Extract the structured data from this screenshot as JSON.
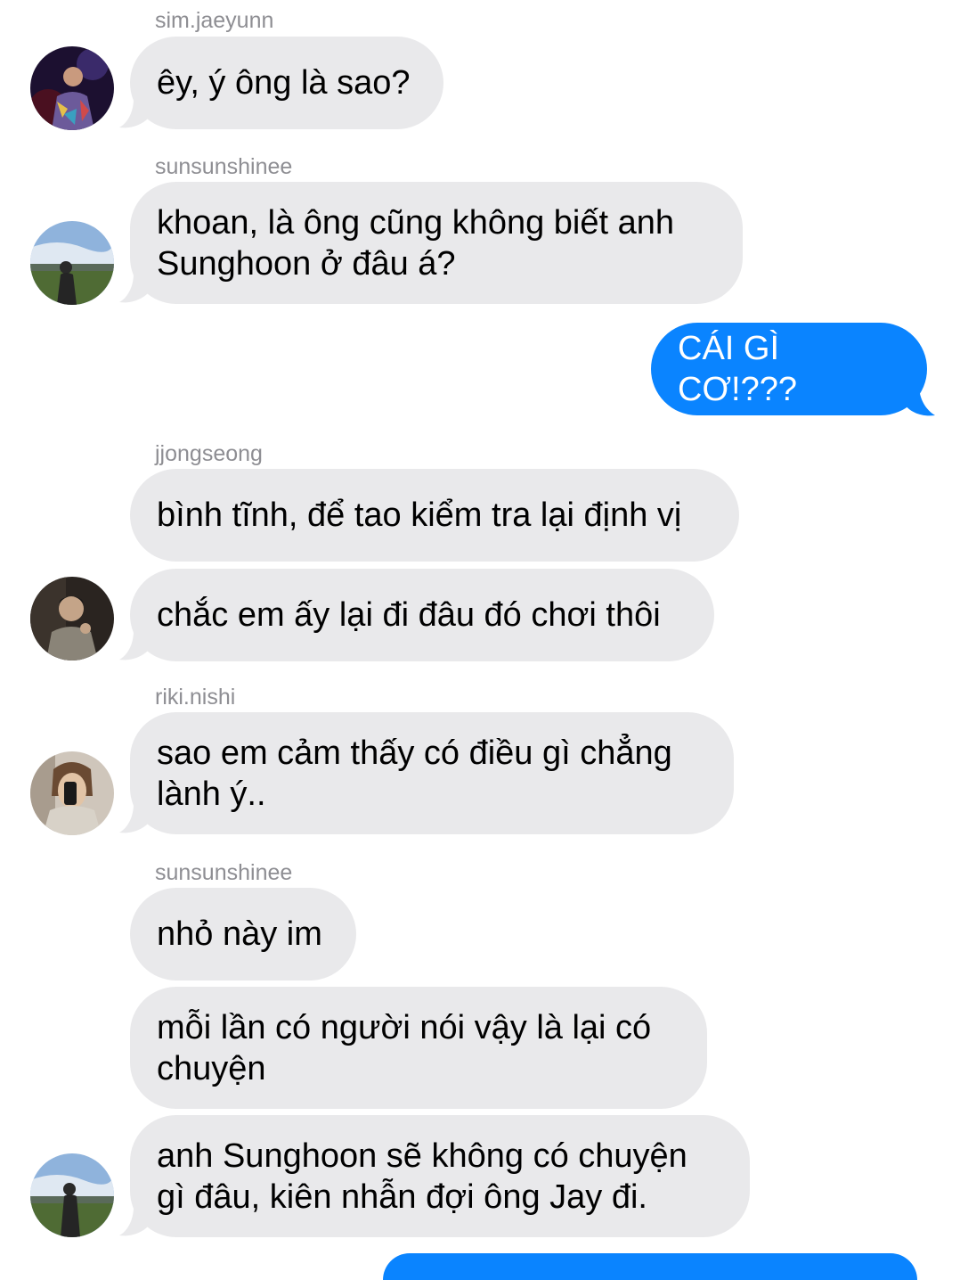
{
  "colors": {
    "incoming_bubble": "#e9e9eb",
    "outgoing_bubble": "#0a84ff",
    "sender_label": "#8e8e93"
  },
  "messages": [
    {
      "sender": "sim.jaeyunn",
      "text": "êy, ý ông là sao?",
      "direction": "incoming",
      "avatar": "avatar-stage-performer"
    },
    {
      "sender": "sunsunshinee",
      "text": "khoan, là ông cũng không biết anh Sunghoon ở đâu á?",
      "direction": "incoming",
      "avatar": "avatar-field-sky"
    },
    {
      "text": "CÁI GÌ CƠ!???",
      "direction": "outgoing"
    },
    {
      "sender": "jjongseong",
      "text": "bình tĩnh, để tao kiểm tra lại định vị",
      "direction": "incoming"
    },
    {
      "text": "chắc em ấy lại đi đâu đó chơi thôi",
      "direction": "incoming",
      "avatar": "avatar-dark-portrait"
    },
    {
      "sender": "riki.nishi",
      "text": "sao em cảm thấy có điều gì chẳng lành ý..",
      "direction": "incoming",
      "avatar": "avatar-mirror-selfie"
    },
    {
      "sender": "sunsunshinee",
      "text": "nhỏ này im",
      "direction": "incoming"
    },
    {
      "text": "mỗi lần có người nói vậy là lại có chuyện",
      "direction": "incoming"
    },
    {
      "text": "anh Sunghoon sẽ không có chuyện gì đâu, kiên nhẫn đợi ông Jay đi.",
      "direction": "incoming",
      "avatar": "avatar-field-sky"
    }
  ]
}
